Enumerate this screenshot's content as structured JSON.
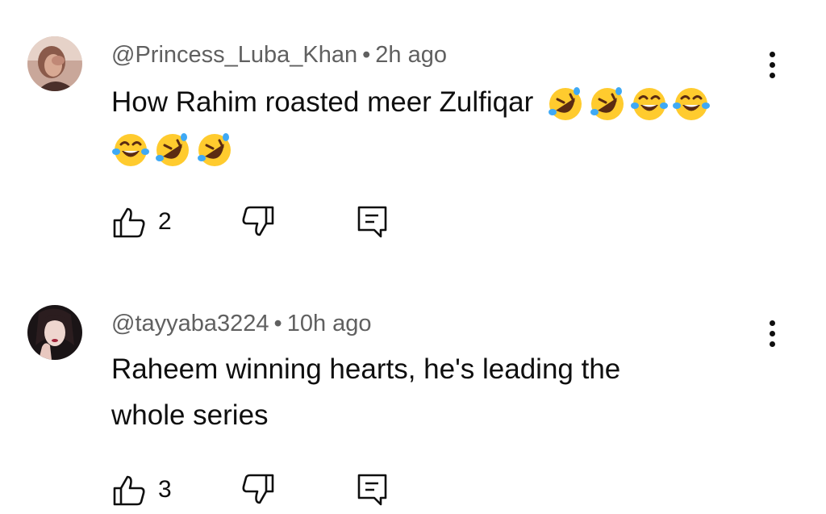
{
  "comments": [
    {
      "author": "@Princess_Luba_Khan",
      "separator": "•",
      "time": "2h ago",
      "text": "How Rahim roasted meer Zulfiqar",
      "emojis_line1": [
        "rofl",
        "rofl",
        "joy",
        "joy"
      ],
      "emojis_line2": [
        "joy",
        "rofl",
        "rofl"
      ],
      "likes": "2"
    },
    {
      "author": "@tayyaba3224",
      "separator": "•",
      "time": "10h ago",
      "text_line1": "Raheem winning hearts, he's leading the",
      "text_line2": "whole series",
      "likes": "3"
    }
  ],
  "icons": {
    "like": "thumbs-up-icon",
    "dislike": "thumbs-down-icon",
    "reply": "reply-icon",
    "more": "more-vertical-icon"
  }
}
